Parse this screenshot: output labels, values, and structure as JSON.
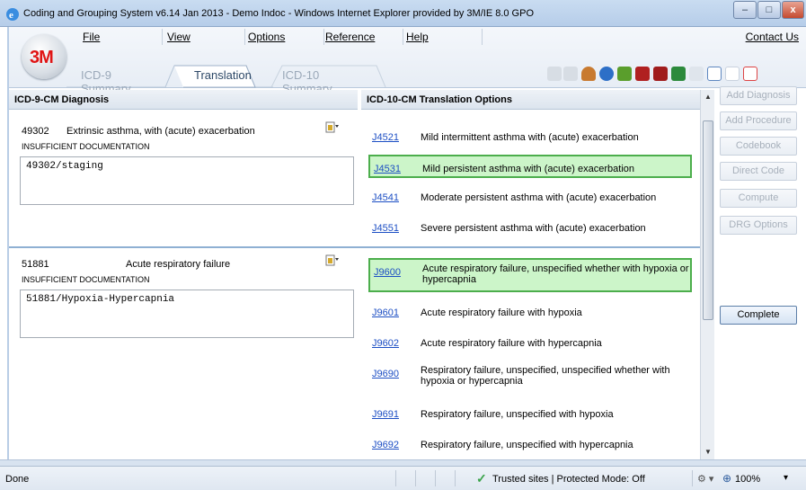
{
  "window": {
    "title": "Coding and Grouping System v6.14 Jan 2013 - Demo Indoc - Windows Internet Explorer provided by 3M/IE 8.0 GPO",
    "minimize": "–",
    "maximize": "□",
    "close": "x"
  },
  "app": {
    "logo_text": "3M",
    "menu": [
      "File",
      "View",
      "Options",
      "Reference",
      "Help"
    ],
    "contact": "Contact Us",
    "tabs": [
      "ICD-9 Summary",
      "Translation",
      "ICD-10 Summary"
    ]
  },
  "left": {
    "header": "ICD-9-CM Diagnosis",
    "diagnoses": [
      {
        "code": "49302",
        "desc": "Extrinsic asthma, with (acute) exacerbation",
        "status": "INSUFFICIENT DOCUMENTATION",
        "note": "49302/staging"
      },
      {
        "code": "51881",
        "desc": "Acute respiratory failure",
        "status": "INSUFFICIENT DOCUMENTATION",
        "note": "51881/Hypoxia-Hypercapnia"
      }
    ]
  },
  "right": {
    "header": "ICD-10-CM Translation Options",
    "options": [
      {
        "code": "J4521",
        "desc": "Mild intermittent asthma with (acute) exacerbation"
      },
      {
        "code": "J4531",
        "desc": "Mild persistent asthma with (acute) exacerbation",
        "selected": true
      },
      {
        "code": "J4541",
        "desc": "Moderate persistent asthma with (acute) exacerbation"
      },
      {
        "code": "J4551",
        "desc": "Severe persistent asthma with (acute) exacerbation"
      },
      {
        "code": "J9600",
        "desc": "Acute respiratory failure, unspecified whether with hypoxia or hypercapnia",
        "selected": true
      },
      {
        "code": "J9601",
        "desc": "Acute respiratory failure with hypoxia"
      },
      {
        "code": "J9602",
        "desc": "Acute respiratory failure with hypercapnia"
      },
      {
        "code": "J9690",
        "desc": "Respiratory failure, unspecified, unspecified whether with hypoxia or hypercapnia"
      },
      {
        "code": "J9691",
        "desc": "Respiratory failure, unspecified with hypoxia"
      },
      {
        "code": "J9692",
        "desc": "Respiratory failure, unspecified with hypercapnia"
      }
    ]
  },
  "sidebar": {
    "buttons": [
      "Add Diagnosis",
      "Add Procedure",
      "Codebook",
      "Direct Code",
      "Compute",
      "DRG Options"
    ],
    "complete": "Complete"
  },
  "status": {
    "left": "Done",
    "zone": "Trusted sites | Protected Mode: Off",
    "zoom": "100%"
  },
  "colors": {
    "selected_bg": "#ccf5c9",
    "selected_border": "#4cae4c",
    "link": "#1d4fc4"
  }
}
